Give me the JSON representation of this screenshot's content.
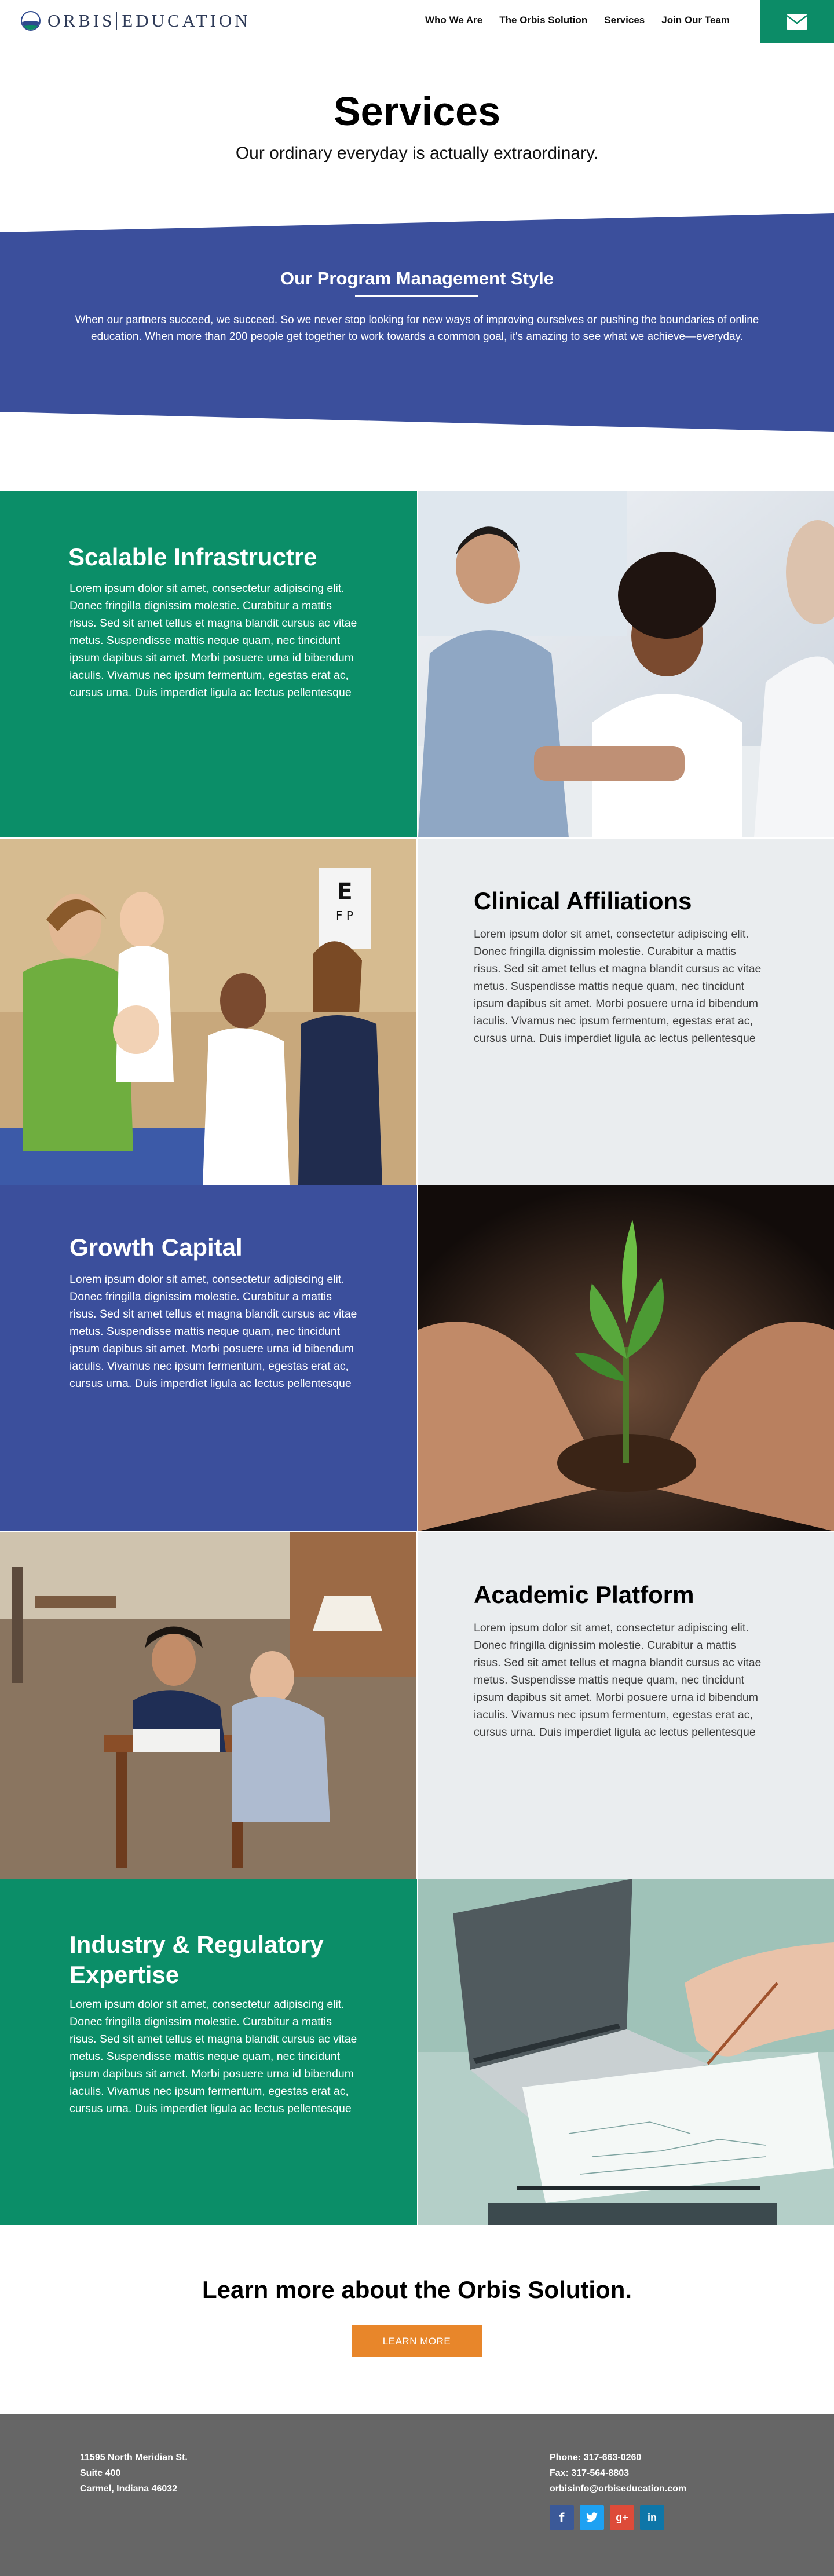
{
  "brand": {
    "logo_text_left": "ORBIS",
    "logo_text_right": "EDUCATION"
  },
  "nav": {
    "items": [
      {
        "label": "Who We Are"
      },
      {
        "label": "The Orbis Solution"
      },
      {
        "label": "Services"
      },
      {
        "label": "Join Our Team"
      }
    ],
    "mail_icon": "envelope-icon"
  },
  "hero": {
    "title": "Services",
    "subtitle": "Our ordinary everyday is actually extraordinary."
  },
  "band": {
    "title": "Our Program Management Style",
    "text": "When our partners succeed, we succeed. So we never stop looking for new ways of improving ourselves or pushing the boundaries of online education. When more than 200 people get together to work towards a common goal, it's amazing to see what we achieve—everyday."
  },
  "sections": [
    {
      "title": "Scalable Infrastructre",
      "body": "Lorem ipsum dolor sit amet, consectetur adipiscing elit. Donec fringilla dignissim molestie. Curabitur a mattis risus. Sed sit amet tellus et magna blandit cursus ac vitae metus. Suspendisse mattis neque quam, nec tincidunt ipsum dapibus sit amet. Morbi posuere urna id bibendum iaculis. Vivamus nec ipsum fermentum, egestas erat ac, cursus urna. Duis imperdiet ligula ac lectus pellentesque",
      "image": "business-meeting-photo"
    },
    {
      "title": "Clinical Affiliations",
      "body": "Lorem ipsum dolor sit amet, consectetur adipiscing elit. Donec fringilla dignissim molestie. Curabitur a mattis risus. Sed sit amet tellus et magna blandit cursus ac vitae metus. Suspendisse mattis neque quam, nec tincidunt ipsum dapibus sit amet. Morbi posuere urna id bibendum iaculis. Vivamus nec ipsum fermentum, egestas erat ac, cursus urna. Duis imperdiet ligula ac lectus pellentesque",
      "image": "clinic-photo"
    },
    {
      "title": "Growth Capital",
      "body": "Lorem ipsum dolor sit amet, consectetur adipiscing elit. Donec fringilla dignissim molestie. Curabitur a mattis risus. Sed sit amet tellus et magna blandit cursus ac vitae metus. Suspendisse mattis neque quam, nec tincidunt ipsum dapibus sit amet. Morbi posuere urna id bibendum iaculis. Vivamus nec ipsum fermentum, egestas erat ac, cursus urna. Duis imperdiet ligula ac lectus pellentesque",
      "image": "seedling-hands-photo"
    },
    {
      "title": "Academic Platform",
      "body": "Lorem ipsum dolor sit amet, consectetur adipiscing elit. Donec fringilla dignissim molestie. Curabitur a mattis risus. Sed sit amet tellus et magna blandit cursus ac vitae metus. Suspendisse mattis neque quam, nec tincidunt ipsum dapibus sit amet. Morbi posuere urna id bibendum iaculis. Vivamus nec ipsum fermentum, egestas erat ac, cursus urna. Duis imperdiet ligula ac lectus pellentesque",
      "image": "library-students-photo"
    },
    {
      "title": "Industry & Regulatory Expertise",
      "body": "Lorem ipsum dolor sit amet, consectetur adipiscing elit. Donec fringilla dignissim molestie. Curabitur a mattis risus. Sed sit amet tellus et magna blandit cursus ac vitae metus. Suspendisse mattis neque quam, nec tincidunt ipsum dapibus sit amet. Morbi posuere urna id bibendum iaculis. Vivamus nec ipsum fermentum, egestas erat ac, cursus urna. Duis imperdiet ligula ac lectus pellentesque",
      "image": "laptop-paperwork-photo"
    }
  ],
  "cta": {
    "title": "Learn more about the Orbis Solution.",
    "button": "LEARN MORE"
  },
  "footer": {
    "address": [
      "11595 North Meridian St.",
      "Suite 400",
      "Carmel, Indiana 46032"
    ],
    "phone": "Phone: 317-663-0260",
    "fax": "Fax: 317-564-8803",
    "email": "orbisinfo@orbiseducation.com",
    "social": [
      {
        "icon": "facebook-icon",
        "glyph": "f",
        "color": "#3b5998"
      },
      {
        "icon": "twitter-icon",
        "glyph": "t",
        "color": "#1da1f2"
      },
      {
        "icon": "google-plus-icon",
        "glyph": "g+",
        "color": "#dd4b39"
      },
      {
        "icon": "linkedin-icon",
        "glyph": "in",
        "color": "#0e76a8"
      }
    ]
  },
  "colors": {
    "green": "#0b8e68",
    "blue": "#3b4f9c",
    "light_gray": "#eaedef",
    "orange": "#e8862a",
    "footer_gray": "#666666"
  }
}
